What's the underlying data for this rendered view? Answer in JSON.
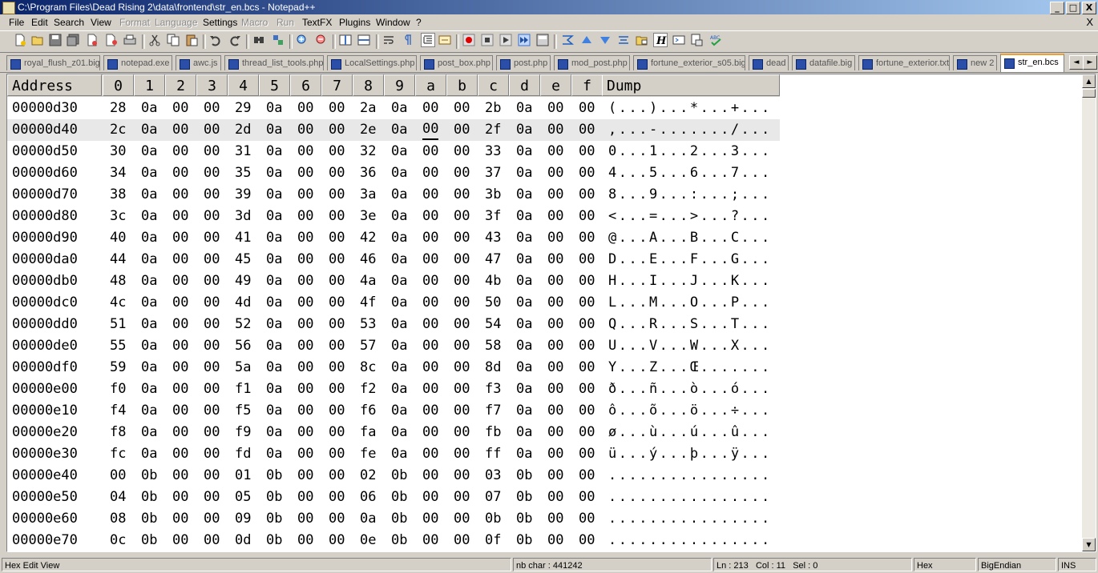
{
  "window": {
    "title": "C:\\Program Files\\Dead Rising 2\\data\\frontend\\str_en.bcs - Notepad++",
    "controls": [
      "_",
      "□",
      "X"
    ]
  },
  "menu": {
    "items": [
      {
        "label": "File",
        "enabled": true
      },
      {
        "label": "Edit",
        "enabled": true
      },
      {
        "label": "Search",
        "enabled": true
      },
      {
        "label": "View",
        "enabled": true
      },
      {
        "label": "Format",
        "enabled": false
      },
      {
        "label": "Language",
        "enabled": false
      },
      {
        "label": "Settings",
        "enabled": true
      },
      {
        "label": "Macro",
        "enabled": false
      },
      {
        "label": "Run",
        "enabled": false
      },
      {
        "label": "TextFX",
        "enabled": true
      },
      {
        "label": "Plugins",
        "enabled": true
      },
      {
        "label": "Window",
        "enabled": true
      },
      {
        "label": "?",
        "enabled": true
      }
    ],
    "close": "X"
  },
  "toolbar": {
    "buttons": [
      "new-file-icon",
      "open-file-icon",
      "save-icon",
      "save-all-icon",
      "close-icon",
      "close-all-icon",
      "print-icon",
      "cut-icon",
      "copy-icon",
      "paste-icon",
      "undo-icon",
      "redo-icon",
      "find-icon",
      "replace-icon",
      "zoom-in-icon",
      "zoom-out-icon",
      "sync-vertical-icon",
      "sync-horizontal-icon",
      "word-wrap-icon",
      "show-all-chars-icon",
      "indent-guide-icon",
      "hex-view-icon",
      "record-macro-icon",
      "stop-macro-icon",
      "play-macro-icon",
      "run-macro-multiple-icon",
      "save-macro-icon",
      "hex-compare-icon",
      "hex-prev-icon",
      "hex-next-icon",
      "hex-diff-icon",
      "hex-open-icon",
      "hex-h-icon",
      "hex-insert-icon",
      "hex-pattern-icon",
      "spell-check-icon"
    ]
  },
  "tabs": {
    "items": [
      {
        "label": "royal_flush_z01.big",
        "active": false
      },
      {
        "label": "notepad.exe",
        "active": false
      },
      {
        "label": "awc.js",
        "active": false
      },
      {
        "label": "thread_list_tools.php",
        "active": false
      },
      {
        "label": "LocalSettings.php",
        "active": false
      },
      {
        "label": "post_box.php",
        "active": false
      },
      {
        "label": "post.php",
        "active": false
      },
      {
        "label": "mod_post.php",
        "active": false
      },
      {
        "label": "fortune_exterior_s05.big",
        "active": false
      },
      {
        "label": "dead",
        "active": false
      },
      {
        "label": "datafile.big",
        "active": false
      },
      {
        "label": "fortune_exterior.txt",
        "active": false
      },
      {
        "label": "new 2",
        "active": false
      },
      {
        "label": "str_en.bcs",
        "active": true
      }
    ],
    "nav": [
      "◄",
      "►"
    ]
  },
  "hex": {
    "header": {
      "address": "Address",
      "columns": [
        "0",
        "1",
        "2",
        "3",
        "4",
        "5",
        "6",
        "7",
        "8",
        "9",
        "a",
        "b",
        "c",
        "d",
        "e",
        "f"
      ],
      "dump": "Dump"
    },
    "selected_row": 1,
    "caret": {
      "row": 1,
      "col": 10
    },
    "rows": [
      {
        "addr": "00000d30",
        "bytes": [
          "28",
          "0a",
          "00",
          "00",
          "29",
          "0a",
          "00",
          "00",
          "2a",
          "0a",
          "00",
          "00",
          "2b",
          "0a",
          "00",
          "00"
        ],
        "dump": "(...)...*...+..."
      },
      {
        "addr": "00000d40",
        "bytes": [
          "2c",
          "0a",
          "00",
          "00",
          "2d",
          "0a",
          "00",
          "00",
          "2e",
          "0a",
          "00",
          "00",
          "2f",
          "0a",
          "00",
          "00"
        ],
        "dump": ",...-......./..."
      },
      {
        "addr": "00000d50",
        "bytes": [
          "30",
          "0a",
          "00",
          "00",
          "31",
          "0a",
          "00",
          "00",
          "32",
          "0a",
          "00",
          "00",
          "33",
          "0a",
          "00",
          "00"
        ],
        "dump": "0...1...2...3..."
      },
      {
        "addr": "00000d60",
        "bytes": [
          "34",
          "0a",
          "00",
          "00",
          "35",
          "0a",
          "00",
          "00",
          "36",
          "0a",
          "00",
          "00",
          "37",
          "0a",
          "00",
          "00"
        ],
        "dump": "4...5...6...7..."
      },
      {
        "addr": "00000d70",
        "bytes": [
          "38",
          "0a",
          "00",
          "00",
          "39",
          "0a",
          "00",
          "00",
          "3a",
          "0a",
          "00",
          "00",
          "3b",
          "0a",
          "00",
          "00"
        ],
        "dump": "8...9...:...;..."
      },
      {
        "addr": "00000d80",
        "bytes": [
          "3c",
          "0a",
          "00",
          "00",
          "3d",
          "0a",
          "00",
          "00",
          "3e",
          "0a",
          "00",
          "00",
          "3f",
          "0a",
          "00",
          "00"
        ],
        "dump": "<...=...>...?..."
      },
      {
        "addr": "00000d90",
        "bytes": [
          "40",
          "0a",
          "00",
          "00",
          "41",
          "0a",
          "00",
          "00",
          "42",
          "0a",
          "00",
          "00",
          "43",
          "0a",
          "00",
          "00"
        ],
        "dump": "@...A...B...C..."
      },
      {
        "addr": "00000da0",
        "bytes": [
          "44",
          "0a",
          "00",
          "00",
          "45",
          "0a",
          "00",
          "00",
          "46",
          "0a",
          "00",
          "00",
          "47",
          "0a",
          "00",
          "00"
        ],
        "dump": "D...E...F...G..."
      },
      {
        "addr": "00000db0",
        "bytes": [
          "48",
          "0a",
          "00",
          "00",
          "49",
          "0a",
          "00",
          "00",
          "4a",
          "0a",
          "00",
          "00",
          "4b",
          "0a",
          "00",
          "00"
        ],
        "dump": "H...I...J...K..."
      },
      {
        "addr": "00000dc0",
        "bytes": [
          "4c",
          "0a",
          "00",
          "00",
          "4d",
          "0a",
          "00",
          "00",
          "4f",
          "0a",
          "00",
          "00",
          "50",
          "0a",
          "00",
          "00"
        ],
        "dump": "L...M...O...P..."
      },
      {
        "addr": "00000dd0",
        "bytes": [
          "51",
          "0a",
          "00",
          "00",
          "52",
          "0a",
          "00",
          "00",
          "53",
          "0a",
          "00",
          "00",
          "54",
          "0a",
          "00",
          "00"
        ],
        "dump": "Q...R...S...T..."
      },
      {
        "addr": "00000de0",
        "bytes": [
          "55",
          "0a",
          "00",
          "00",
          "56",
          "0a",
          "00",
          "00",
          "57",
          "0a",
          "00",
          "00",
          "58",
          "0a",
          "00",
          "00"
        ],
        "dump": "U...V...W...X..."
      },
      {
        "addr": "00000df0",
        "bytes": [
          "59",
          "0a",
          "00",
          "00",
          "5a",
          "0a",
          "00",
          "00",
          "8c",
          "0a",
          "00",
          "00",
          "8d",
          "0a",
          "00",
          "00"
        ],
        "dump": "Y...Z...Œ......."
      },
      {
        "addr": "00000e00",
        "bytes": [
          "f0",
          "0a",
          "00",
          "00",
          "f1",
          "0a",
          "00",
          "00",
          "f2",
          "0a",
          "00",
          "00",
          "f3",
          "0a",
          "00",
          "00"
        ],
        "dump": "ð...ñ...ò...ó..."
      },
      {
        "addr": "00000e10",
        "bytes": [
          "f4",
          "0a",
          "00",
          "00",
          "f5",
          "0a",
          "00",
          "00",
          "f6",
          "0a",
          "00",
          "00",
          "f7",
          "0a",
          "00",
          "00"
        ],
        "dump": "ô...õ...ö...÷..."
      },
      {
        "addr": "00000e20",
        "bytes": [
          "f8",
          "0a",
          "00",
          "00",
          "f9",
          "0a",
          "00",
          "00",
          "fa",
          "0a",
          "00",
          "00",
          "fb",
          "0a",
          "00",
          "00"
        ],
        "dump": "ø...ù...ú...û..."
      },
      {
        "addr": "00000e30",
        "bytes": [
          "fc",
          "0a",
          "00",
          "00",
          "fd",
          "0a",
          "00",
          "00",
          "fe",
          "0a",
          "00",
          "00",
          "ff",
          "0a",
          "00",
          "00"
        ],
        "dump": "ü...ý...þ...ÿ..."
      },
      {
        "addr": "00000e40",
        "bytes": [
          "00",
          "0b",
          "00",
          "00",
          "01",
          "0b",
          "00",
          "00",
          "02",
          "0b",
          "00",
          "00",
          "03",
          "0b",
          "00",
          "00"
        ],
        "dump": "................"
      },
      {
        "addr": "00000e50",
        "bytes": [
          "04",
          "0b",
          "00",
          "00",
          "05",
          "0b",
          "00",
          "00",
          "06",
          "0b",
          "00",
          "00",
          "07",
          "0b",
          "00",
          "00"
        ],
        "dump": "................"
      },
      {
        "addr": "00000e60",
        "bytes": [
          "08",
          "0b",
          "00",
          "00",
          "09",
          "0b",
          "00",
          "00",
          "0a",
          "0b",
          "00",
          "00",
          "0b",
          "0b",
          "00",
          "00"
        ],
        "dump": "................"
      },
      {
        "addr": "00000e70",
        "bytes": [
          "0c",
          "0b",
          "00",
          "00",
          "0d",
          "0b",
          "00",
          "00",
          "0e",
          "0b",
          "00",
          "00",
          "0f",
          "0b",
          "00",
          "00"
        ],
        "dump": "................"
      }
    ]
  },
  "scrollbar": {
    "up": "▲",
    "down": "▼"
  },
  "status": {
    "mode": "Hex Edit View",
    "nb_char": "nb char : 441242",
    "ln": "Ln : 213",
    "col": "Col : 11",
    "sel": "Sel : 0",
    "encoding": "Hex",
    "endian": "BigEndian",
    "ins": "INS"
  }
}
